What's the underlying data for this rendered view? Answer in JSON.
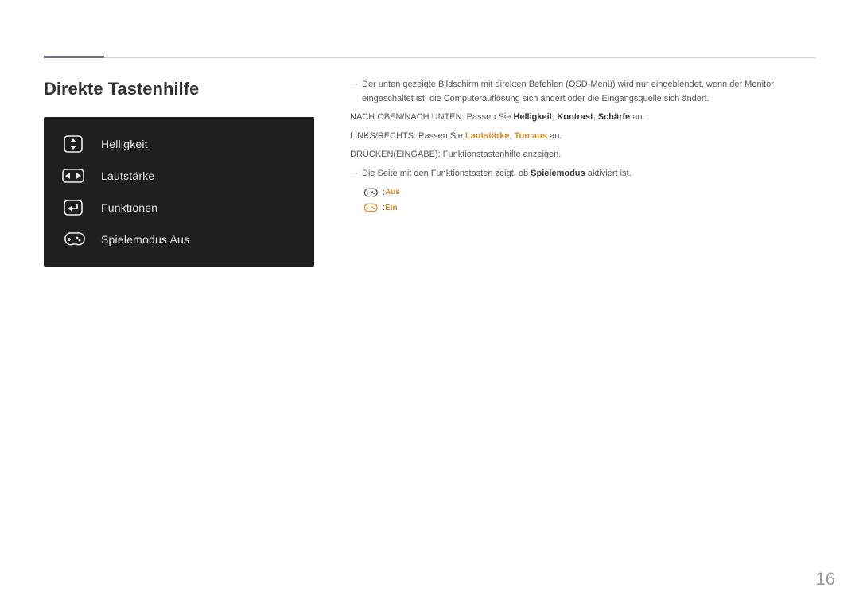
{
  "page": {
    "number": "16"
  },
  "title": "Direkte Tastenhilfe",
  "osd": {
    "items": [
      {
        "label": "Helligkeit"
      },
      {
        "label": "Lautstärke"
      },
      {
        "label": "Funktionen"
      },
      {
        "label": "Spielemodus Aus"
      }
    ]
  },
  "notes": {
    "n1": "Der unten gezeigte Bildschirm mit direkten Befehlen (OSD-Menü) wird nur eingeblendet, wenn der Monitor eingeschaltet ist, die Computerauflösung sich ändert oder die Eingangsquelle sich ändert.",
    "l1a": "NACH OBEN/NACH UNTEN: Passen Sie ",
    "l1_kw1": "Helligkeit",
    "l1_sep1": ", ",
    "l1_kw2": "Kontrast",
    "l1_sep2": ", ",
    "l1_kw3": "Schärfe",
    "l1b": " an.",
    "l2a": "LINKS/RECHTS: Passen Sie ",
    "l2_kw1": "Lautstärke",
    "l2_sep1": ", ",
    "l2_kw2": "Ton aus",
    "l2b": " an.",
    "l3": "DRÜCKEN(EINGABE): Funktionstastenhilfe anzeigen.",
    "n2a": "Die Seite mit den Funktionstasten zeigt, ob ",
    "n2_kw": "Spielemodus",
    "n2b": " aktiviert ist.",
    "status_off": "Aus",
    "status_on": "Ein"
  }
}
